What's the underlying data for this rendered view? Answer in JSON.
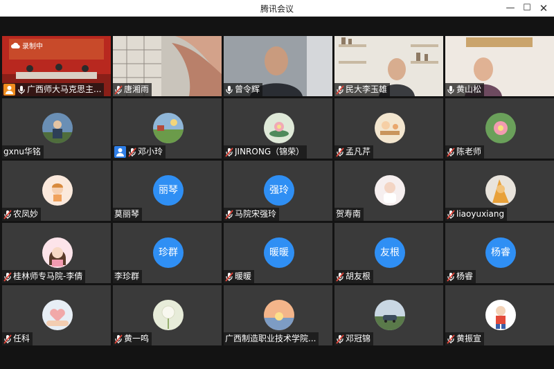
{
  "window": {
    "title": "腾讯会议",
    "minimize_icon": "minimize-icon",
    "maximize_icon": "maximize-icon",
    "close_icon": "close-icon"
  },
  "recording": {
    "label": "录制中",
    "icon": "cloud-record-icon"
  },
  "participants": [
    {
      "name": "广西师大马克思主...",
      "type": "video",
      "badge": "host",
      "mic": "on",
      "scene": "conference"
    },
    {
      "name": "唐湘雨",
      "type": "video",
      "mic": "muted",
      "scene": "hand"
    },
    {
      "name": "曾令辉",
      "type": "video",
      "mic": "on",
      "scene": "man-bald"
    },
    {
      "name": "民大李玉雄",
      "type": "video",
      "mic": "muted",
      "scene": "man-shelf"
    },
    {
      "name": "黄山松",
      "type": "video",
      "mic": "on",
      "scene": "man-wall"
    },
    {
      "name": "gxnu华铭",
      "type": "photo",
      "mic": "none",
      "photo": "person-outdoor"
    },
    {
      "name": "邓小玲",
      "type": "photo",
      "badge": "cohost",
      "mic": "muted",
      "photo": "landscape"
    },
    {
      "name": "JINRONG（锦荣）",
      "type": "photo",
      "mic": "muted",
      "photo": "lotus-painting"
    },
    {
      "name": "孟凡芹",
      "type": "photo",
      "mic": "muted",
      "photo": "cartoon-table"
    },
    {
      "name": "陈老师",
      "type": "photo",
      "mic": "muted",
      "photo": "pink-flower"
    },
    {
      "name": "农凤妙",
      "type": "photo",
      "mic": "muted",
      "photo": "cartoon-girl"
    },
    {
      "name": "莫丽琴",
      "type": "text",
      "mic": "none",
      "initials": "丽琴"
    },
    {
      "name": "马院宋强玲",
      "type": "text",
      "mic": "muted",
      "initials": "强玲"
    },
    {
      "name": "贺寿南",
      "type": "photo",
      "mic": "none",
      "photo": "baby"
    },
    {
      "name": "liaoyuxiang",
      "type": "photo",
      "mic": "muted",
      "photo": "orange-kitten"
    },
    {
      "name": "桂林师专马院-李倩",
      "type": "photo",
      "mic": "muted",
      "photo": "cartoon-woman"
    },
    {
      "name": "李珍群",
      "type": "text",
      "mic": "none",
      "initials": "珍群"
    },
    {
      "name": "暖暖",
      "type": "text",
      "mic": "muted",
      "initials": "暖暖"
    },
    {
      "name": "胡友根",
      "type": "text",
      "mic": "muted",
      "initials": "友根"
    },
    {
      "name": "杨睿",
      "type": "text",
      "mic": "muted",
      "initials": "杨睿"
    },
    {
      "name": "任科",
      "type": "photo",
      "mic": "muted",
      "photo": "hands-heart"
    },
    {
      "name": "黄一鸣",
      "type": "photo",
      "mic": "muted",
      "photo": "dandelion"
    },
    {
      "name": "广西制造职业技术学院...",
      "type": "photo",
      "mic": "none",
      "photo": "sunset-lake"
    },
    {
      "name": "邓冠锦",
      "type": "photo",
      "mic": "muted",
      "photo": "car-trees"
    },
    {
      "name": "黄振宣",
      "type": "photo",
      "mic": "muted",
      "photo": "cartoon-boy"
    }
  ],
  "colors": {
    "stage_bg": "#131313",
    "tile_bg": "#3a3a3a",
    "avatar_blue": "#2f8ff4",
    "muted_red": "#e0453a",
    "host_badge": "#f08c1e",
    "cohost_badge": "#2f7fe8"
  }
}
